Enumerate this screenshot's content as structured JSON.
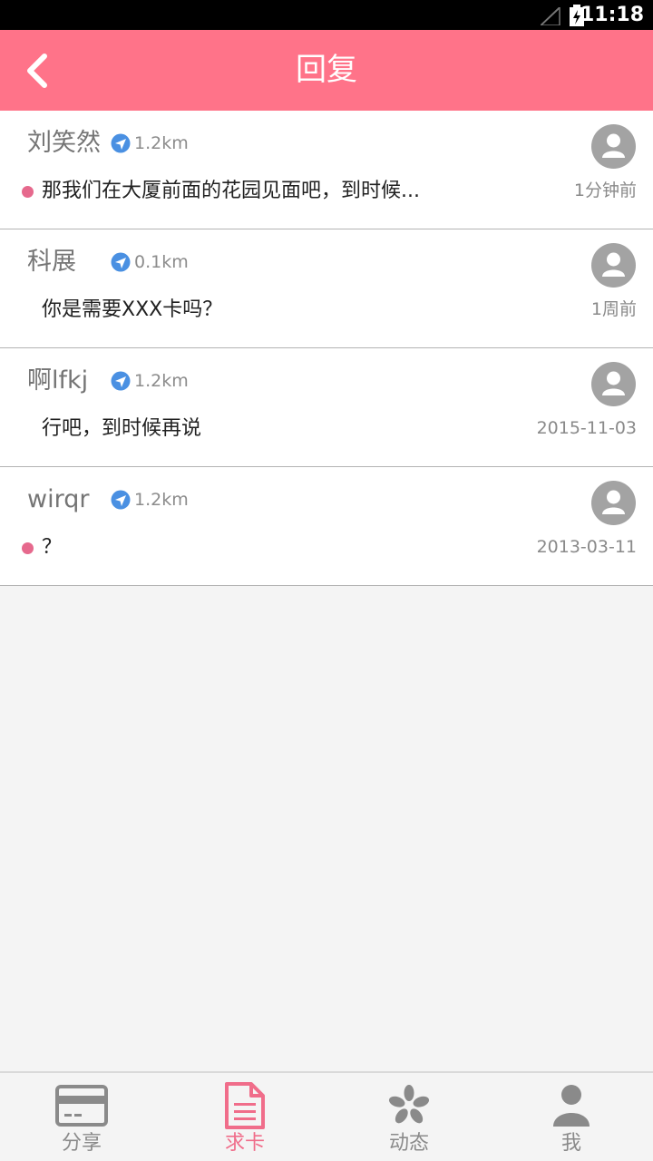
{
  "status_bar": {
    "time": "11:18"
  },
  "header": {
    "title": "回复",
    "back_icon": "chevron-left-icon"
  },
  "colors": {
    "accent": "#ff7389",
    "unread_dot": "#e6698d",
    "location_icon": "#4a90e2",
    "active_tab": "#f06d8a"
  },
  "replies": [
    {
      "name": "刘笑然",
      "distance": "1.2km",
      "message": "那我们在大厦前面的花园见面吧，到时候...",
      "time": "1分钟前",
      "unread": true
    },
    {
      "name": "科展",
      "distance": "0.1km",
      "message": "你是需要XXX卡吗？",
      "time": "1周前",
      "unread": false
    },
    {
      "name": "啊lfkj",
      "distance": "1.2km",
      "message": "行吧，到时候再说",
      "time": "2015-11-03",
      "unread": false
    },
    {
      "name": "wirqr",
      "distance": "1.2km",
      "message": "？",
      "time": "2013-03-11",
      "unread": true
    }
  ],
  "tabs": [
    {
      "label": "分享",
      "icon": "card-icon",
      "active": false
    },
    {
      "label": "求卡",
      "icon": "document-icon",
      "active": true
    },
    {
      "label": "动态",
      "icon": "pinwheel-icon",
      "active": false
    },
    {
      "label": "我",
      "icon": "person-icon",
      "active": false
    }
  ]
}
